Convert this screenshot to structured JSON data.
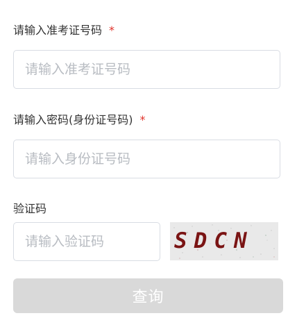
{
  "form": {
    "exam_number": {
      "label": "请输入准考证号码",
      "required_mark": "*",
      "placeholder": "请输入准考证号码",
      "value": ""
    },
    "password": {
      "label": "请输入密码(身份证号码)",
      "required_mark": "*",
      "placeholder": "请输入身份证号码",
      "value": ""
    },
    "captcha": {
      "label": "验证码",
      "placeholder": "请输入验证码",
      "value": "",
      "image_text": "SDCN",
      "image_text_color": "#7a1414"
    },
    "submit_label": "查询"
  },
  "colors": {
    "required": "#e0322a",
    "border": "#d8dce3",
    "placeholder": "#b8bcc2",
    "button_bg": "#d9d9d9",
    "button_text": "#ffffff"
  }
}
